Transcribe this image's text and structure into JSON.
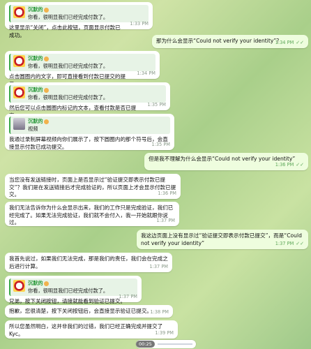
{
  "messages": [
    {
      "kind": "in",
      "reply": {
        "name": "沉默的",
        "text": "你看，很明显我们已经完成付款了。"
      },
      "text": "这里显示“关闭”，点击此按钮，页面显示付款已成功。",
      "time": "1:33 PM"
    },
    {
      "kind": "out",
      "text": "那为什么会显示“Could not verify your identity”？",
      "time": "1:34 PM",
      "check": "✓✓"
    },
    {
      "kind": "in",
      "reply": {
        "name": "沉默的",
        "text": "你看，很明显我们已经完成付款了。"
      },
      "text": "点击圆圈内的文字，即可直接看到付款已提交的提示。",
      "time": "1:34 PM"
    },
    {
      "kind": "in",
      "reply": {
        "name": "沉默的",
        "text": "你看，很明显我们已经完成付款了。"
      },
      "text": "然后您可以点击圆圈内标记的文本，查看付款是否已提交。",
      "time": "1:35 PM"
    },
    {
      "kind": "in",
      "reply": {
        "name": "沉默的",
        "text": "视频"
      },
      "text": "我通过录制屏幕视频向你们展示了，按下圆圈内的那个符号后，会直接显示付款已成功提交。",
      "time": "1:35 PM"
    },
    {
      "kind": "out",
      "text": "但是我不理解为什么会显示“Could not verify your identity”",
      "time": "1:36 PM",
      "check": "✓✓"
    },
    {
      "kind": "in",
      "text": "当您没有发送链接时，页面上是否显示过“验证提交即表示付款已提交”？我们是在发送链接后才完成验证的，所以页面上才会显示付款已提交。",
      "time": "1:36 PM"
    },
    {
      "kind": "in",
      "text": "我们无法告诉你为什么会显示出来，我们的工作只是完成验证，我们已经完成了。如果无法完成验证，我们就不会付入，我一开始就跟你说过。",
      "time": "1:37 PM"
    },
    {
      "kind": "out",
      "text": "我这边页面上没有显示过“验证提交即表示付款已提交”，而是“Could not verify your identity”",
      "time": "1:37 PM",
      "check": "✓✓"
    },
    {
      "kind": "in",
      "text": "我首先说过，如果我们无法完成，那是我们的责任，我们会在完成之后进行计算。",
      "time": "1:37 PM"
    },
    {
      "kind": "in",
      "reply": {
        "name": "沉默的",
        "text": "你看，很明显我们已经完成付款了。"
      },
      "text": "兄弟，按下关闭按钮，请接就能看到验证已提交。",
      "time": "1:37 PM"
    },
    {
      "kind": "in",
      "text": "抱歉，您很清楚，按下关闭按钮后，会直接显示验证已提交。",
      "time": "1:38 PM"
    },
    {
      "kind": "in",
      "text": "所以您虽然明白，这并非我们的过错，我们已经正确完成并提交了Kyc。",
      "time": "1:39 PM"
    }
  ],
  "bottom": {
    "time": "00:25"
  }
}
